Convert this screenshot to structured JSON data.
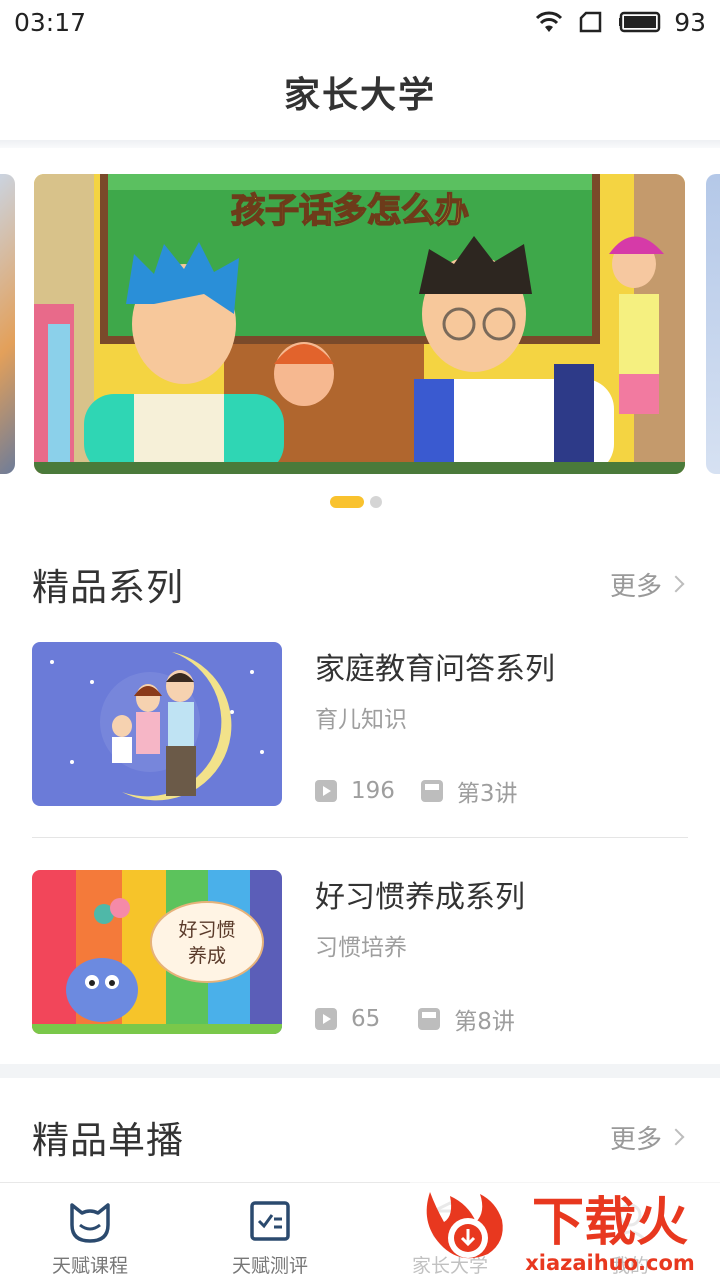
{
  "status_bar": {
    "time": "03:17",
    "battery": "93"
  },
  "header": {
    "title": "家长大学"
  },
  "banner": {
    "headline": "孩子话多怎么办",
    "active_index": 0,
    "total": 2
  },
  "sections": [
    {
      "title": "精品系列",
      "more_label": "更多",
      "items": [
        {
          "title": "家庭教育问答系列",
          "subtitle": "育儿知识",
          "plays": "196",
          "lessons": "第3讲"
        },
        {
          "title": "好习惯养成系列",
          "subtitle": "习惯培养",
          "plays": "65",
          "lessons": "第8讲",
          "thumb_text": "好习惯养成"
        }
      ]
    },
    {
      "title": "精品单播",
      "more_label": "更多"
    }
  ],
  "bottom_nav": {
    "items": [
      {
        "label": "天赋课程",
        "icon": "cat-face-icon"
      },
      {
        "label": "天赋测评",
        "icon": "assessment-book-icon"
      },
      {
        "label": "家长大学",
        "icon": "parent-university-icon",
        "active": true
      },
      {
        "label": "我的",
        "icon": "profile-icon"
      }
    ]
  },
  "watermark": {
    "brand": "下载火",
    "domain": "xiazaihuo.com"
  },
  "colors": {
    "accent": "#f9c22e",
    "text": "#333333",
    "muted": "#9e9e9e",
    "watermark_red": "#e8381f"
  }
}
